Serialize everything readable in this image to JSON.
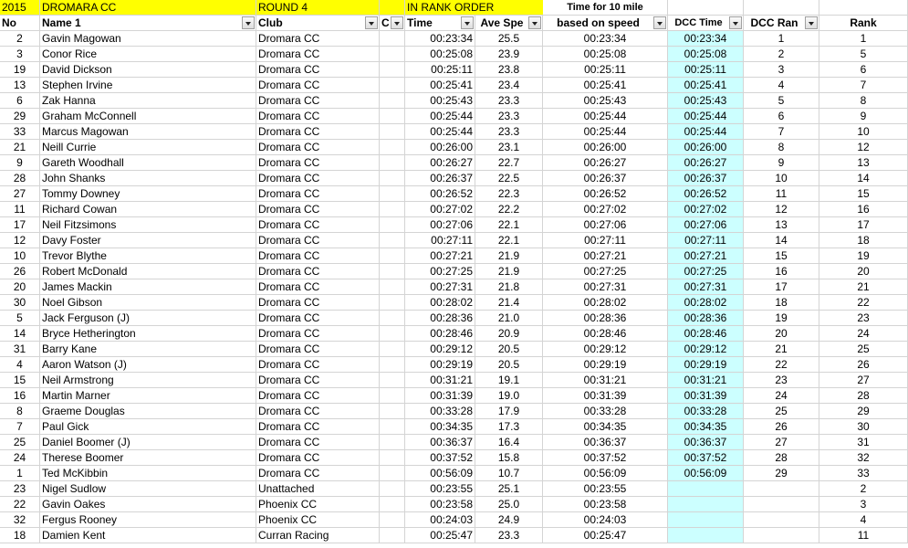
{
  "sheet": {
    "header_row1": {
      "year": "2015",
      "club": "DROMARA CC",
      "round": "ROUND 4",
      "order": "IN RANK ORDER",
      "time_note": "Time for 10 mile"
    },
    "columns": {
      "no": "No",
      "name": "Name 1",
      "club": "Club",
      "c": "C",
      "time": "Time",
      "ave_speed": "Ave Spe",
      "based_on_speed": "based on speed",
      "dcc_time": "DCC Time",
      "dcc_rank": "DCC Ran",
      "rank": "Rank"
    },
    "colors": {
      "header_fill": "#ffff00",
      "dcc_fill": "#ccffff",
      "gridline": "#d4d4d4"
    },
    "rows": [
      {
        "no": "2",
        "name": "Gavin Magowan",
        "club": "Dromara CC",
        "time": "00:23:34",
        "speed": "25.5",
        "based": "00:23:34",
        "dcc_time": "00:23:34",
        "dcc_rank": "1",
        "rank": "1"
      },
      {
        "no": "3",
        "name": "Conor Rice",
        "club": "Dromara CC",
        "time": "00:25:08",
        "speed": "23.9",
        "based": "00:25:08",
        "dcc_time": "00:25:08",
        "dcc_rank": "2",
        "rank": "5"
      },
      {
        "no": "19",
        "name": "David Dickson",
        "club": "Dromara CC",
        "time": "00:25:11",
        "speed": "23.8",
        "based": "00:25:11",
        "dcc_time": "00:25:11",
        "dcc_rank": "3",
        "rank": "6"
      },
      {
        "no": "13",
        "name": "Stephen Irvine",
        "club": "Dromara CC",
        "time": "00:25:41",
        "speed": "23.4",
        "based": "00:25:41",
        "dcc_time": "00:25:41",
        "dcc_rank": "4",
        "rank": "7"
      },
      {
        "no": "6",
        "name": "Zak Hanna",
        "club": "Dromara CC",
        "time": "00:25:43",
        "speed": "23.3",
        "based": "00:25:43",
        "dcc_time": "00:25:43",
        "dcc_rank": "5",
        "rank": "8"
      },
      {
        "no": "29",
        "name": "Graham McConnell",
        "club": "Dromara CC",
        "time": "00:25:44",
        "speed": "23.3",
        "based": "00:25:44",
        "dcc_time": "00:25:44",
        "dcc_rank": "6",
        "rank": "9"
      },
      {
        "no": "33",
        "name": "Marcus Magowan",
        "club": "Dromara CC",
        "time": "00:25:44",
        "speed": "23.3",
        "based": "00:25:44",
        "dcc_time": "00:25:44",
        "dcc_rank": "7",
        "rank": "10"
      },
      {
        "no": "21",
        "name": "Neill Currie",
        "club": "Dromara CC",
        "time": "00:26:00",
        "speed": "23.1",
        "based": "00:26:00",
        "dcc_time": "00:26:00",
        "dcc_rank": "8",
        "rank": "12"
      },
      {
        "no": "9",
        "name": "Gareth Woodhall",
        "club": "Dromara CC",
        "time": "00:26:27",
        "speed": "22.7",
        "based": "00:26:27",
        "dcc_time": "00:26:27",
        "dcc_rank": "9",
        "rank": "13"
      },
      {
        "no": "28",
        "name": "John Shanks",
        "club": "Dromara CC",
        "time": "00:26:37",
        "speed": "22.5",
        "based": "00:26:37",
        "dcc_time": "00:26:37",
        "dcc_rank": "10",
        "rank": "14"
      },
      {
        "no": "27",
        "name": "Tommy Downey",
        "club": "Dromara CC",
        "time": "00:26:52",
        "speed": "22.3",
        "based": "00:26:52",
        "dcc_time": "00:26:52",
        "dcc_rank": "11",
        "rank": "15"
      },
      {
        "no": "11",
        "name": "Richard Cowan",
        "club": "Dromara CC",
        "time": "00:27:02",
        "speed": "22.2",
        "based": "00:27:02",
        "dcc_time": "00:27:02",
        "dcc_rank": "12",
        "rank": "16"
      },
      {
        "no": "17",
        "name": "Neil Fitzsimons",
        "club": "Dromara CC",
        "time": "00:27:06",
        "speed": "22.1",
        "based": "00:27:06",
        "dcc_time": "00:27:06",
        "dcc_rank": "13",
        "rank": "17"
      },
      {
        "no": "12",
        "name": "Davy Foster",
        "club": "Dromara CC",
        "time": "00:27:11",
        "speed": "22.1",
        "based": "00:27:11",
        "dcc_time": "00:27:11",
        "dcc_rank": "14",
        "rank": "18"
      },
      {
        "no": "10",
        "name": "Trevor Blythe",
        "club": "Dromara CC",
        "time": "00:27:21",
        "speed": "21.9",
        "based": "00:27:21",
        "dcc_time": "00:27:21",
        "dcc_rank": "15",
        "rank": "19"
      },
      {
        "no": "26",
        "name": "Robert McDonald",
        "club": "Dromara CC",
        "time": "00:27:25",
        "speed": "21.9",
        "based": "00:27:25",
        "dcc_time": "00:27:25",
        "dcc_rank": "16",
        "rank": "20"
      },
      {
        "no": "20",
        "name": "James Mackin",
        "club": "Dromara CC",
        "time": "00:27:31",
        "speed": "21.8",
        "based": "00:27:31",
        "dcc_time": "00:27:31",
        "dcc_rank": "17",
        "rank": "21"
      },
      {
        "no": "30",
        "name": "Noel Gibson",
        "club": "Dromara CC",
        "time": "00:28:02",
        "speed": "21.4",
        "based": "00:28:02",
        "dcc_time": "00:28:02",
        "dcc_rank": "18",
        "rank": "22"
      },
      {
        "no": "5",
        "name": "Jack Ferguson (J)",
        "club": "Dromara CC",
        "time": "00:28:36",
        "speed": "21.0",
        "based": "00:28:36",
        "dcc_time": "00:28:36",
        "dcc_rank": "19",
        "rank": "23"
      },
      {
        "no": "14",
        "name": "Bryce Hetherington",
        "club": "Dromara CC",
        "time": "00:28:46",
        "speed": "20.9",
        "based": "00:28:46",
        "dcc_time": "00:28:46",
        "dcc_rank": "20",
        "rank": "24"
      },
      {
        "no": "31",
        "name": "Barry Kane",
        "club": "Dromara CC",
        "time": "00:29:12",
        "speed": "20.5",
        "based": "00:29:12",
        "dcc_time": "00:29:12",
        "dcc_rank": "21",
        "rank": "25"
      },
      {
        "no": "4",
        "name": "Aaron Watson (J)",
        "club": "Dromara CC",
        "time": "00:29:19",
        "speed": "20.5",
        "based": "00:29:19",
        "dcc_time": "00:29:19",
        "dcc_rank": "22",
        "rank": "26"
      },
      {
        "no": "15",
        "name": "Neil Armstrong",
        "club": "Dromara CC",
        "time": "00:31:21",
        "speed": "19.1",
        "based": "00:31:21",
        "dcc_time": "00:31:21",
        "dcc_rank": "23",
        "rank": "27"
      },
      {
        "no": "16",
        "name": "Martin Marner",
        "club": "Dromara CC",
        "time": "00:31:39",
        "speed": "19.0",
        "based": "00:31:39",
        "dcc_time": "00:31:39",
        "dcc_rank": "24",
        "rank": "28"
      },
      {
        "no": "8",
        "name": "Graeme Douglas",
        "club": "Dromara CC",
        "time": "00:33:28",
        "speed": "17.9",
        "based": "00:33:28",
        "dcc_time": "00:33:28",
        "dcc_rank": "25",
        "rank": "29"
      },
      {
        "no": "7",
        "name": "Paul Gick",
        "club": "Dromara CC",
        "time": "00:34:35",
        "speed": "17.3",
        "based": "00:34:35",
        "dcc_time": "00:34:35",
        "dcc_rank": "26",
        "rank": "30"
      },
      {
        "no": "25",
        "name": "Daniel Boomer (J)",
        "club": "Dromara CC",
        "time": "00:36:37",
        "speed": "16.4",
        "based": "00:36:37",
        "dcc_time": "00:36:37",
        "dcc_rank": "27",
        "rank": "31"
      },
      {
        "no": "24",
        "name": "Therese Boomer",
        "club": "Dromara CC",
        "time": "00:37:52",
        "speed": "15.8",
        "based": "00:37:52",
        "dcc_time": "00:37:52",
        "dcc_rank": "28",
        "rank": "32"
      },
      {
        "no": "1",
        "name": "Ted McKibbin",
        "club": "Dromara CC",
        "time": "00:56:09",
        "speed": "10.7",
        "based": "00:56:09",
        "dcc_time": "00:56:09",
        "dcc_rank": "29",
        "rank": "33"
      },
      {
        "no": "23",
        "name": "Nigel Sudlow",
        "club": "Unattached",
        "time": "00:23:55",
        "speed": "25.1",
        "based": "00:23:55",
        "dcc_time": "",
        "dcc_rank": "",
        "rank": "2"
      },
      {
        "no": "22",
        "name": "Gavin Oakes",
        "club": "Phoenix CC",
        "time": "00:23:58",
        "speed": "25.0",
        "based": "00:23:58",
        "dcc_time": "",
        "dcc_rank": "",
        "rank": "3"
      },
      {
        "no": "32",
        "name": "Fergus Rooney",
        "club": "Phoenix CC",
        "time": "00:24:03",
        "speed": "24.9",
        "based": "00:24:03",
        "dcc_time": "",
        "dcc_rank": "",
        "rank": "4"
      },
      {
        "no": "18",
        "name": "Damien Kent",
        "club": "Curran Racing",
        "time": "00:25:47",
        "speed": "23.3",
        "based": "00:25:47",
        "dcc_time": "",
        "dcc_rank": "",
        "rank": "11"
      }
    ]
  }
}
